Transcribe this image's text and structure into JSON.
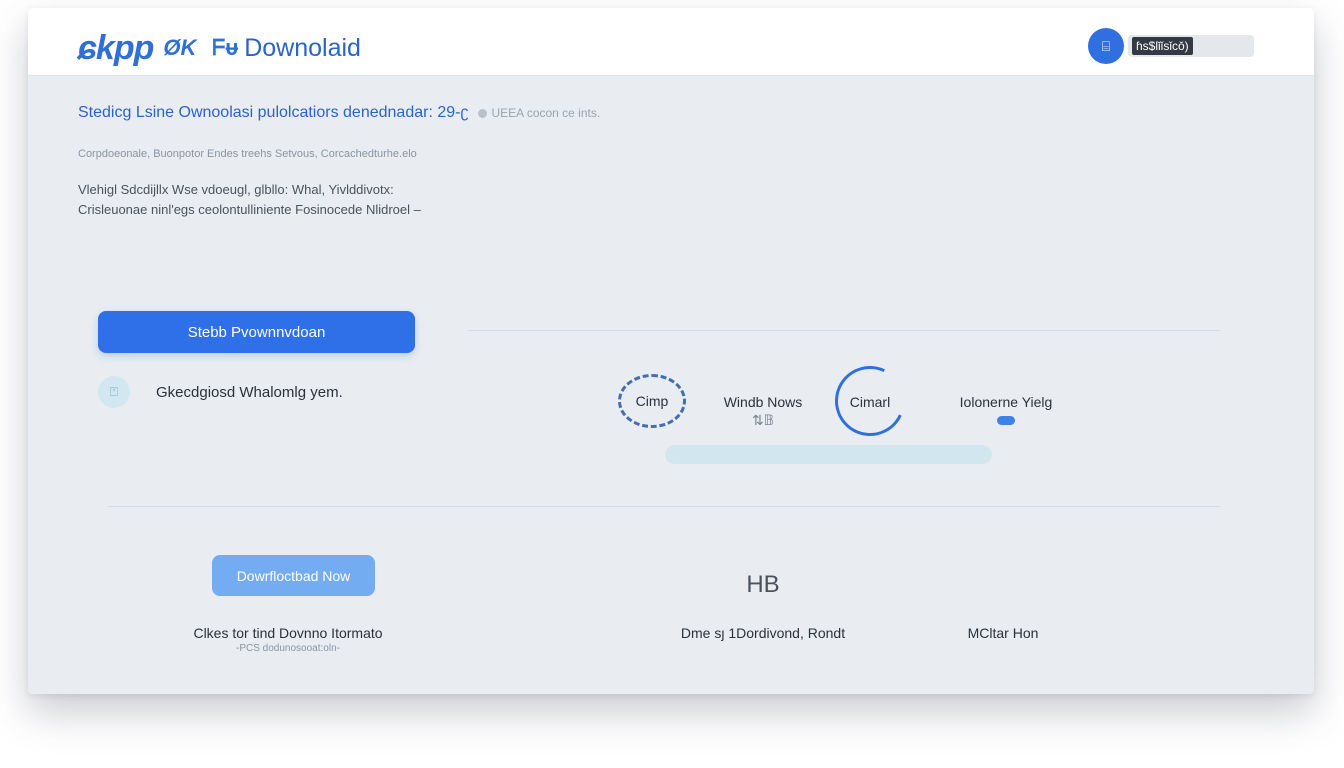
{
  "header": {
    "logo_mark": "ɕkpp",
    "logo_sub": "ØK",
    "logo_icon": "ᖴᵾ",
    "logo_text": "Downolaid",
    "user_icon": "⌸",
    "user_label": "ɦs$lǐǐsǐcǒ)"
  },
  "intro": {
    "heading": "Stedicg Lsine Ownoolasi pulolcatiors denednadar: 29-ʗ",
    "heading_note": "UEEA cocon ce ints.",
    "breadcrumb": "Corpdoeonale, Buonpotor Endes treehs Setvous, Corcachedturhe.elo",
    "desc_line1": "Vlehigl Sdcdijllx Wse vdoeugl, glbllo: Whal, Yivlddivotx:",
    "desc_line2": "Crisleuonae ninl'egs ceolontulliniente Fosinocede Nlidroel –"
  },
  "primary_action": {
    "button_label": "Stebb Pvownnvdoan",
    "hint_icon": "⍞",
    "hint_text": "Gkecdgiosd Whalomlg yem."
  },
  "steps": {
    "step1_label": "Cimp",
    "step2_label": "Windb Nows",
    "step2_icon": "⇅𝔹",
    "step3_label": "Cimarl",
    "step4_label": "Iolonerne Yielg"
  },
  "secondary_action": {
    "button_label": "Dowrfloctbad Now",
    "caption_main": "Clkes tor tind Dovnno Itormato",
    "caption_sub": "-PCS dodunosooat:oln-"
  },
  "meta": {
    "unit": "HB",
    "label1": "Dme sȷ 1Dordivond, Rondt",
    "label2": "MCltar Hon"
  }
}
